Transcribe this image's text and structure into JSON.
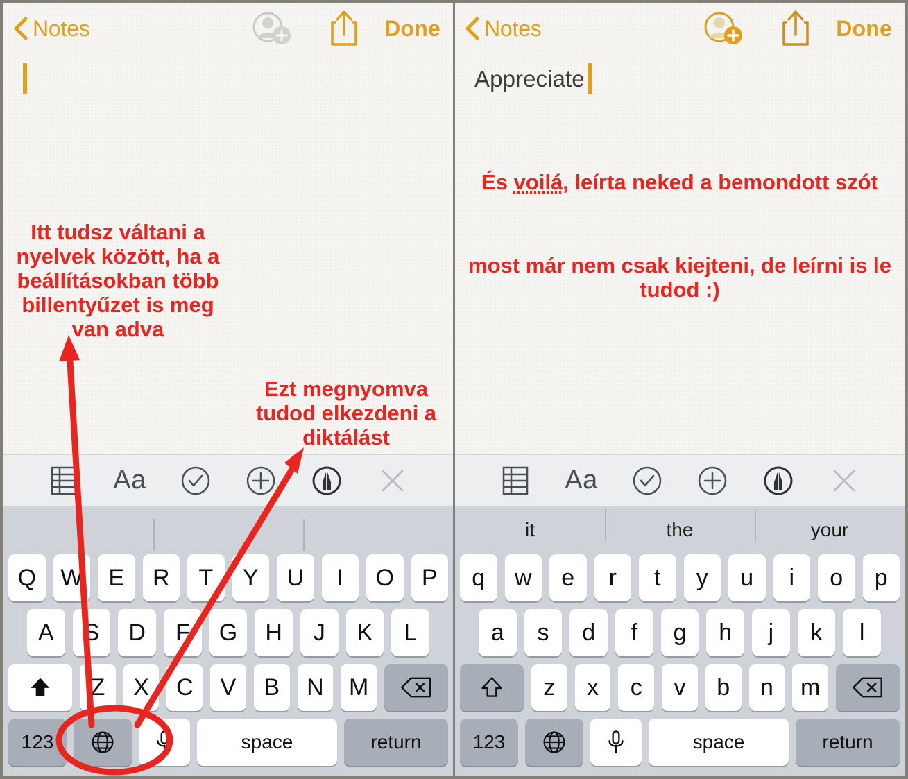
{
  "colors": {
    "accent_orange": "#e0a01e",
    "annotation_red": "#e8251f",
    "toolbar_bg": "#eceef0",
    "keyboard_bg": "#cfd3d9",
    "key_white": "#ffffff",
    "key_dark": "#a8aeb8",
    "note_text": "#3c3c3e",
    "frame_border": "#827f79"
  },
  "panels": [
    {
      "id": "left",
      "navbar": {
        "back_label": "Notes",
        "back_icon": "chevron-left-icon",
        "add_person_icon": "add-person-icon",
        "add_person_enabled": false,
        "share_icon": "share-icon",
        "done_label": "Done"
      },
      "note": {
        "text": "",
        "caret_visible": true
      },
      "annotations": [
        {
          "id": "a1",
          "text": "Itt tudsz váltani a nyelvek között, ha a beállításokban több billentyűzet is meg van adva"
        },
        {
          "id": "a2",
          "text": "Ezt megnyomva tudod elkezdeni a diktálást"
        }
      ],
      "toolbar": [
        {
          "icon": "table-icon",
          "label": "Table"
        },
        {
          "icon": "text-format-icon",
          "label": "Aa"
        },
        {
          "icon": "checklist-circle-icon",
          "label": "Checklist"
        },
        {
          "icon": "plus-circle-icon",
          "label": "Add"
        },
        {
          "icon": "markup-pen-icon",
          "label": "Markup"
        },
        {
          "icon": "close-x-icon",
          "label": "Close"
        }
      ],
      "keyboard": {
        "predictions": [
          "",
          "",
          ""
        ],
        "shift_active": true,
        "rows": [
          [
            "Q",
            "W",
            "E",
            "R",
            "T",
            "Y",
            "U",
            "I",
            "O",
            "P"
          ],
          [
            "A",
            "S",
            "D",
            "F",
            "G",
            "H",
            "J",
            "K",
            "L"
          ],
          [
            "Z",
            "X",
            "C",
            "V",
            "B",
            "N",
            "M"
          ]
        ],
        "shift_icon": "shift-filled-icon",
        "backspace_icon": "backspace-icon",
        "numbers_label": "123",
        "globe_icon": "globe-icon",
        "mic_icon": "microphone-icon",
        "space_label": "space",
        "return_label": "return"
      }
    },
    {
      "id": "right",
      "navbar": {
        "back_label": "Notes",
        "back_icon": "chevron-left-icon",
        "add_person_icon": "add-person-icon",
        "add_person_enabled": true,
        "share_icon": "share-icon",
        "done_label": "Done"
      },
      "note": {
        "text": "Appreciate",
        "caret_visible": true
      },
      "annotations": [
        {
          "id": "a3",
          "text_before": "És ",
          "text_misspelled": "voilá",
          "text_after": ", leírta neked a bemondott szót"
        },
        {
          "id": "a4",
          "text": "most már nem csak kiejteni, de leírni is le tudod :)"
        }
      ],
      "toolbar": [
        {
          "icon": "table-icon",
          "label": "Table"
        },
        {
          "icon": "text-format-icon",
          "label": "Aa"
        },
        {
          "icon": "checklist-circle-icon",
          "label": "Checklist"
        },
        {
          "icon": "plus-circle-icon",
          "label": "Add"
        },
        {
          "icon": "markup-pen-icon",
          "label": "Markup"
        },
        {
          "icon": "close-x-icon",
          "label": "Close"
        }
      ],
      "keyboard": {
        "predictions": [
          "it",
          "the",
          "your"
        ],
        "shift_active": false,
        "rows": [
          [
            "q",
            "w",
            "e",
            "r",
            "t",
            "y",
            "u",
            "i",
            "o",
            "p"
          ],
          [
            "a",
            "s",
            "d",
            "f",
            "g",
            "h",
            "j",
            "k",
            "l"
          ],
          [
            "z",
            "x",
            "c",
            "v",
            "b",
            "n",
            "m"
          ]
        ],
        "shift_icon": "shift-outline-icon",
        "backspace_icon": "backspace-icon",
        "numbers_label": "123",
        "globe_icon": "globe-icon",
        "mic_icon": "microphone-icon",
        "space_label": "space",
        "return_label": "return"
      }
    }
  ],
  "markup_shapes": {
    "arrow_to_globe": "red-arrow-pointing-up-to-globe-key",
    "arrow_to_mic": "red-arrow-pointing-up-to-mic-key",
    "highlight_ellipse": "red-ellipse-around-globe-and-mic-keys"
  }
}
